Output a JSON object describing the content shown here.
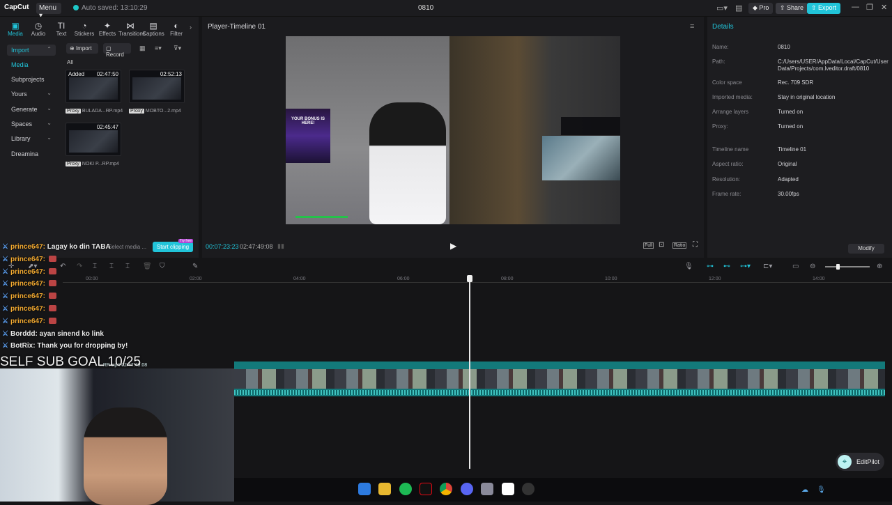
{
  "titlebar": {
    "logo": "CapCut",
    "menu_label": "Menu",
    "autosave": "Auto saved: 13:10:29",
    "project_name": "0810",
    "pro_label": "Pro",
    "share_label": "Share",
    "export_label": "Export"
  },
  "toolbar_tabs": [
    {
      "label": "Media",
      "icon": "▣"
    },
    {
      "label": "Audio",
      "icon": "◷"
    },
    {
      "label": "Text",
      "icon": "TI"
    },
    {
      "label": "Stickers",
      "icon": "◔"
    },
    {
      "label": "Effects",
      "icon": "✦"
    },
    {
      "label": "Transitions",
      "icon": "⋈"
    },
    {
      "label": "Captions",
      "icon": "▤"
    },
    {
      "label": "Filter",
      "icon": "◐"
    }
  ],
  "sidebar": {
    "items": [
      {
        "label": "Import",
        "active": true
      },
      {
        "label": "Media"
      },
      {
        "label": "Subprojects"
      },
      {
        "label": "Yours"
      },
      {
        "label": "Generate"
      },
      {
        "label": "Spaces"
      },
      {
        "label": "Library"
      },
      {
        "label": "Dreamina"
      }
    ]
  },
  "media": {
    "import_label": "Import",
    "record_label": "Record",
    "all_label": "All",
    "clips": [
      {
        "tag": "Added",
        "duration": "02:47:50",
        "name": "BULADA...RP.mp4",
        "proxy": "Proxy"
      },
      {
        "tag": "",
        "duration": "02:52:13",
        "name": "MOBTO...2.mp4",
        "proxy": "Proxy"
      },
      {
        "tag": "",
        "duration": "02:45:47",
        "name": "NOKI P...RP.mp4",
        "proxy": "Proxy"
      }
    ],
    "select_media_label": "Select media ...",
    "start_clipping_label": "Start clipping",
    "try_free_label": "Try free"
  },
  "player": {
    "title": "Player-Timeline 01",
    "current_time": "00:07:23:23",
    "total_time": "02:47:49:08",
    "full_label": "Full",
    "ratio_label": "Ratio",
    "promo_text": "YOUR BONUS IS HERE!"
  },
  "details": {
    "heading": "Details",
    "rows": [
      {
        "key": "Name:",
        "value": "0810"
      },
      {
        "key": "Path:",
        "value": "C:/Users/USER/AppData/Local/CapCut/User Data/Projects/com.lveditor.draft/0810"
      },
      {
        "key": "Color space",
        "value": "Rec. 709 SDR"
      },
      {
        "key": "Imported media:",
        "value": "Stay in original location"
      },
      {
        "key": "Arrange layers",
        "value": "Turned on"
      },
      {
        "key": "Proxy:",
        "value": "Turned on"
      },
      {
        "key": "Timeline name",
        "value": "Timeline 01"
      },
      {
        "key": "Aspect ratio:",
        "value": "Original"
      },
      {
        "key": "Resolution:",
        "value": "Adapted"
      },
      {
        "key": "Frame rate:",
        "value": "30.00fps"
      }
    ],
    "modify_label": "Modify"
  },
  "chat": [
    {
      "user": "prince647:",
      "text": "Lagay ko din TABA"
    },
    {
      "user": "prince647:",
      "text": ""
    },
    {
      "user": "prince647:",
      "text": ""
    },
    {
      "user": "prince647:",
      "text": ""
    },
    {
      "user": "prince647:",
      "text": ""
    },
    {
      "user": "prince647:",
      "text": ""
    },
    {
      "user": "prince647:",
      "text": ""
    },
    {
      "user": "Borddd:",
      "text": "ayan sinend ko link"
    },
    {
      "user": "BotRix:",
      "text": "Thank you for dropping by!"
    }
  ],
  "stream_overlay": {
    "sub_goal": "SELF SUB GOAL 10/25"
  },
  "timeline": {
    "ticks": [
      "00:00",
      "02:00",
      "04:00",
      "06:00",
      "08:00",
      "10:00",
      "12:00",
      "14:00"
    ],
    "track_label": "...RP.mp4  02:47:49:08",
    "playhead_fraction": 0.527
  },
  "editpilot_label": "EditPilot",
  "colors": {
    "accent": "#21c4d9",
    "track": "#13797a",
    "background": "#151517"
  }
}
